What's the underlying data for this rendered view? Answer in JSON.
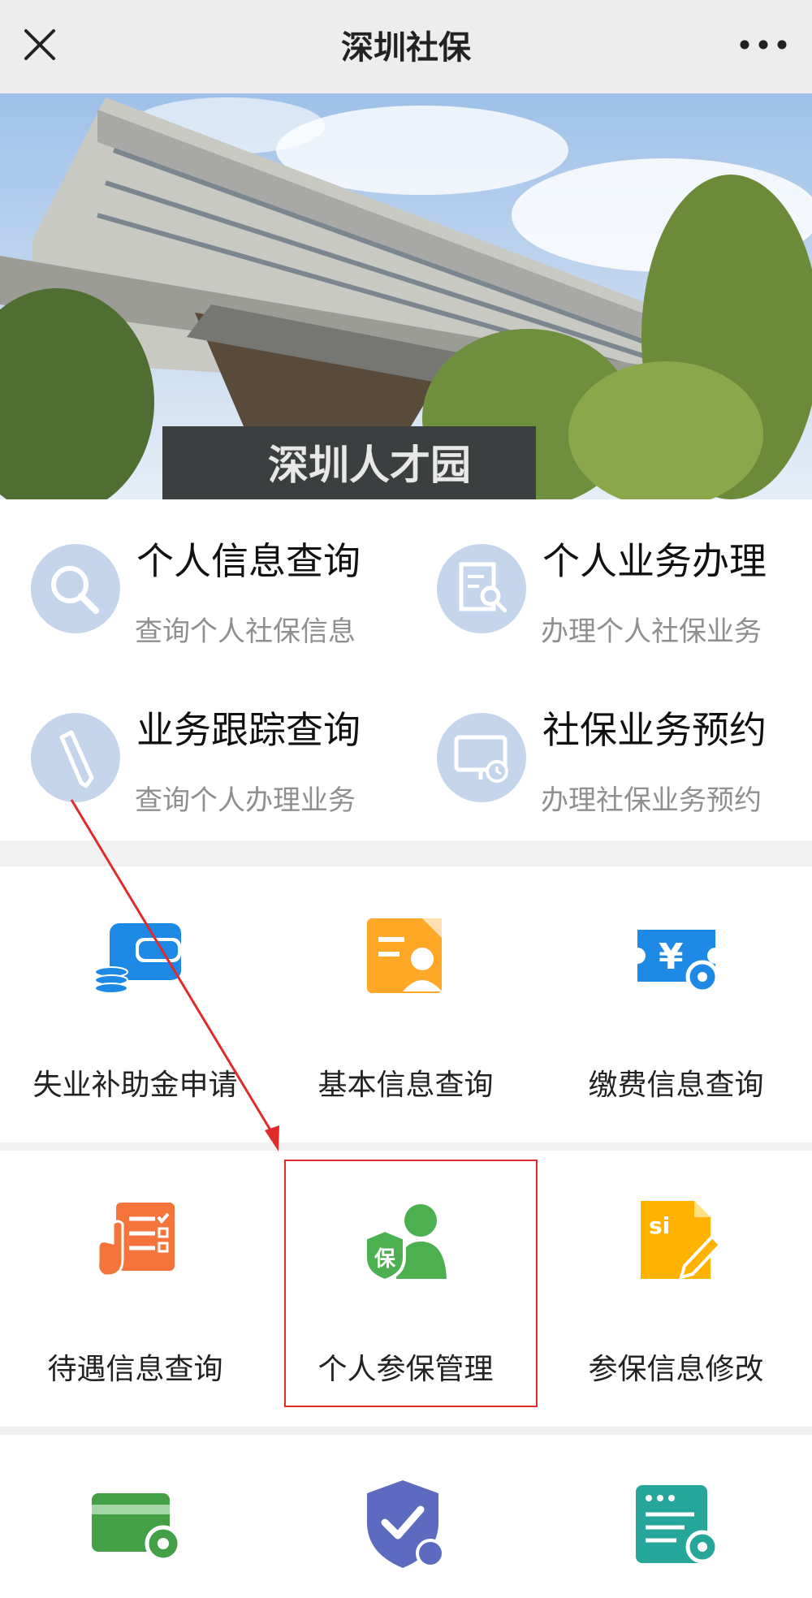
{
  "header": {
    "title": "深圳社保",
    "close_icon": "close-icon",
    "more_icon": "more-icon"
  },
  "banner": {
    "sign_text": "深圳人才园"
  },
  "quick_services": [
    {
      "title": "个人信息查询",
      "subtitle": "查询个人社保信息",
      "icon": "search-icon"
    },
    {
      "title": "个人业务办理",
      "subtitle": "办理个人社保业务",
      "icon": "document-search-icon"
    },
    {
      "title": "业务跟踪查询",
      "subtitle": "查询个人办理业务",
      "icon": "pencil-icon"
    },
    {
      "title": "社保业务预约",
      "subtitle": "办理社保业务预约",
      "icon": "monitor-clock-icon"
    }
  ],
  "grid": [
    {
      "label": "失业补助金申请",
      "icon": "wallet-coins-icon",
      "color": "#1e88e5"
    },
    {
      "label": "基本信息查询",
      "icon": "profile-document-icon",
      "color": "#ffa726"
    },
    {
      "label": "缴费信息查询",
      "icon": "yen-gear-icon",
      "color": "#1e88e5"
    },
    {
      "label": "待遇信息查询",
      "icon": "checklist-hand-icon",
      "color": "#f4743b"
    },
    {
      "label": "个人参保管理",
      "icon": "insured-person-icon",
      "color": "#4caf50",
      "shield_text": "保"
    },
    {
      "label": "参保信息修改",
      "icon": "si-edit-icon",
      "color": "#ffb300",
      "doc_text": "si"
    },
    {
      "label": "",
      "icon": "card-gear-icon",
      "color": "#43a047"
    },
    {
      "label": "",
      "icon": "shield-check-icon",
      "color": "#5c6bc0"
    },
    {
      "label": "",
      "icon": "server-gear-icon",
      "color": "#26a69a"
    }
  ],
  "annotation": {
    "highlight_color": "#e02b2b"
  }
}
